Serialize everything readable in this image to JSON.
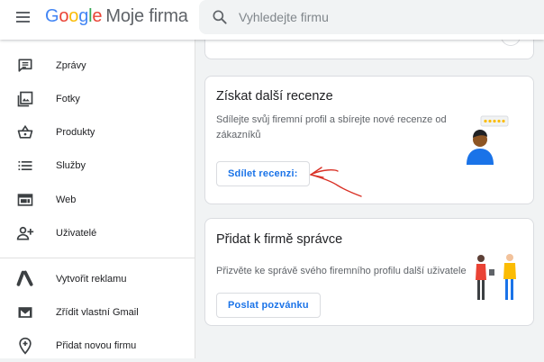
{
  "header": {
    "logo_google": [
      "G",
      "o",
      "o",
      "g",
      "l",
      "e"
    ],
    "logo_suffix": "Moje firma",
    "search_placeholder": "Vyhledejte firmu"
  },
  "sidebar": {
    "items": [
      {
        "label": "Zprávy",
        "icon": "message-icon"
      },
      {
        "label": "Fotky",
        "icon": "photos-icon"
      },
      {
        "label": "Produkty",
        "icon": "basket-icon"
      },
      {
        "label": "Služby",
        "icon": "list-icon"
      },
      {
        "label": "Web",
        "icon": "web-icon"
      },
      {
        "label": "Uživatelé",
        "icon": "add-user-icon"
      },
      {
        "label": "Vytvořit reklamu",
        "icon": "google-ads-icon"
      },
      {
        "label": "Zřídit vlastní Gmail",
        "icon": "gmail-icon"
      },
      {
        "label": "Přidat novou firmu",
        "icon": "add-location-icon"
      }
    ]
  },
  "cards": {
    "reviews": {
      "title": "Získat další recenze",
      "description": "Sdílejte svůj firemní profil a sbírejte nové recenze od zákazníků",
      "button": "Sdílet recenzi:"
    },
    "admin": {
      "title": "Přidat k firmě správce",
      "description": "Přizvěte ke správě svého firemního profilu další uživatele",
      "button": "Poslat pozvánku"
    }
  },
  "colors": {
    "accent": "#1a73e8",
    "arrow": "#d93025"
  }
}
